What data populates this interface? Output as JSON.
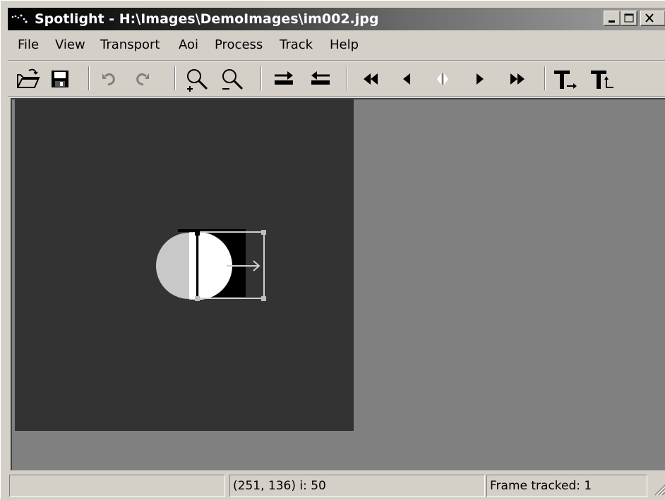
{
  "window": {
    "title": "Spotlight - H:\\Images\\DemoImages\\im002.jpg",
    "icon": "spotlight-app-icon",
    "caption_buttons": [
      "minimize-icon",
      "maximize-icon",
      "close-icon"
    ]
  },
  "menu": {
    "items": [
      {
        "label": "File"
      },
      {
        "label": "View"
      },
      {
        "label": "Transport"
      },
      {
        "label": "Aoi"
      },
      {
        "label": "Process"
      },
      {
        "label": "Track"
      },
      {
        "label": "Help"
      }
    ]
  },
  "toolbar": {
    "buttons": [
      {
        "icon": "open-folder-icon",
        "enabled": true
      },
      {
        "icon": "save-icon",
        "enabled": true
      },
      {
        "icon": "undo-icon",
        "enabled": false
      },
      {
        "icon": "redo-icon",
        "enabled": false
      },
      {
        "icon": "zoom-in-icon",
        "enabled": true
      },
      {
        "icon": "zoom-out-icon",
        "enabled": true
      },
      {
        "icon": "next-image-arrow-icon",
        "enabled": true
      },
      {
        "icon": "previous-image-arrow-icon",
        "enabled": true
      },
      {
        "icon": "rewind-icon",
        "enabled": true
      },
      {
        "icon": "step-back-icon",
        "enabled": true
      },
      {
        "icon": "stop-icon",
        "enabled": false
      },
      {
        "icon": "step-forward-icon",
        "enabled": true
      },
      {
        "icon": "fast-forward-icon",
        "enabled": true
      },
      {
        "icon": "track-forward-icon",
        "enabled": true
      },
      {
        "icon": "track-back-icon",
        "enabled": true
      }
    ]
  },
  "image": {
    "background_color": "#333333",
    "workspace_color": "#808080"
  },
  "statusbar": {
    "pane1": "",
    "pane2": "(251, 136) i: 50",
    "pane3": "Frame tracked: 1"
  }
}
